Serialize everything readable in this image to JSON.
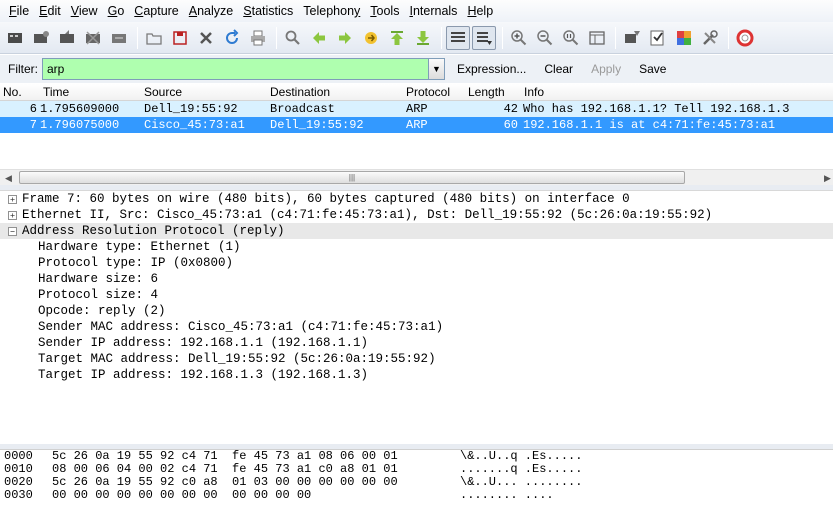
{
  "menu": [
    {
      "pre": "",
      "ul": "F",
      "post": "ile"
    },
    {
      "pre": "",
      "ul": "E",
      "post": "dit"
    },
    {
      "pre": "",
      "ul": "V",
      "post": "iew"
    },
    {
      "pre": "",
      "ul": "G",
      "post": "o"
    },
    {
      "pre": "",
      "ul": "C",
      "post": "apture"
    },
    {
      "pre": "",
      "ul": "A",
      "post": "nalyze"
    },
    {
      "pre": "",
      "ul": "S",
      "post": "tatistics"
    },
    {
      "pre": "Telephon",
      "ul": "y",
      "post": ""
    },
    {
      "pre": "",
      "ul": "T",
      "post": "ools"
    },
    {
      "pre": "",
      "ul": "I",
      "post": "nternals"
    },
    {
      "pre": "",
      "ul": "H",
      "post": "elp"
    }
  ],
  "filter": {
    "label": "Filter:",
    "value": "arp",
    "expression": "Expression...",
    "clear": "Clear",
    "apply": "Apply",
    "save": "Save"
  },
  "packet_list": {
    "columns": [
      "No.",
      "Time",
      "Source",
      "Destination",
      "Protocol",
      "Length",
      "Info"
    ],
    "rows": [
      {
        "no": "6",
        "time": "1.795609000",
        "src": "Dell_19:55:92",
        "dst": "Broadcast",
        "proto": "ARP",
        "len": "42",
        "info": "Who has 192.168.1.1?  Tell 192.168.1.3"
      },
      {
        "no": "7",
        "time": "1.796075000",
        "src": "Cisco_45:73:a1",
        "dst": "Dell_19:55:92",
        "proto": "ARP",
        "len": "60",
        "info": "192.168.1.1 is at c4:71:fe:45:73:a1"
      }
    ]
  },
  "details": {
    "frame": "Frame 7: 60 bytes on wire (480 bits), 60 bytes captured (480 bits) on interface 0",
    "ethernet": "Ethernet II, Src: Cisco_45:73:a1 (c4:71:fe:45:73:a1), Dst: Dell_19:55:92 (5c:26:0a:19:55:92)",
    "arp": "Address Resolution Protocol (reply)",
    "arp_fields": [
      "Hardware type: Ethernet (1)",
      "Protocol type: IP (0x0800)",
      "Hardware size: 6",
      "Protocol size: 4",
      "Opcode: reply (2)",
      "Sender MAC address: Cisco_45:73:a1 (c4:71:fe:45:73:a1)",
      "Sender IP address: 192.168.1.1 (192.168.1.1)",
      "Target MAC address: Dell_19:55:92 (5c:26:0a:19:55:92)",
      "Target IP address: 192.168.1.3 (192.168.1.3)"
    ]
  },
  "hex": [
    {
      "offset": "0000",
      "bytes": "5c 26 0a 19 55 92 c4 71  fe 45 73 a1 08 06 00 01",
      "ascii": "\\&..U..q .Es....."
    },
    {
      "offset": "0010",
      "bytes": "08 00 06 04 00 02 c4 71  fe 45 73 a1 c0 a8 01 01",
      "ascii": ".......q .Es....."
    },
    {
      "offset": "0020",
      "bytes": "5c 26 0a 19 55 92 c0 a8  01 03 00 00 00 00 00 00",
      "ascii": "\\&..U... ........"
    },
    {
      "offset": "0030",
      "bytes": "00 00 00 00 00 00 00 00  00 00 00 00",
      "ascii": "........ ...."
    }
  ],
  "colors": {
    "filter_bg": "#afffaf",
    "selected_row": "#3399ff",
    "arp_row": "#d9f1ff"
  }
}
